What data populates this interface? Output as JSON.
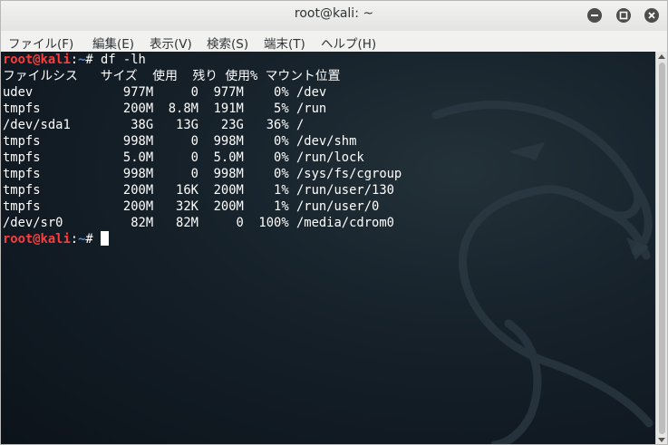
{
  "window": {
    "title": "root@kali: ~"
  },
  "menu": [
    "ファイル(F)",
    "編集(E)",
    "表示(V)",
    "検索(S)",
    "端末(T)",
    "ヘルプ(H)"
  ],
  "terminal": {
    "prompt_user": "root@kali",
    "prompt_sep": ":",
    "prompt_path": "~",
    "prompt_symbol": "#",
    "command": " df -lh",
    "output": [
      "ファイルシス   サイズ  使用  残り 使用% マウント位置",
      "udev            977M     0  977M    0% /dev",
      "tmpfs           200M  8.8M  191M    5% /run",
      "/dev/sda1        38G   13G   23G   36% /",
      "tmpfs           998M     0  998M    0% /dev/shm",
      "tmpfs           5.0M     0  5.0M    0% /run/lock",
      "tmpfs           998M     0  998M    0% /sys/fs/cgroup",
      "tmpfs           200M   16K  200M    1% /run/user/130",
      "tmpfs           200M   32K  200M    1% /run/user/0",
      "/dev/sr0         82M   82M     0  100% /media/cdrom0"
    ]
  },
  "icons": {
    "minimize": "minimize-icon",
    "maximize": "maximize-icon",
    "close": "close-icon",
    "background": "kali-dragon-logo"
  }
}
